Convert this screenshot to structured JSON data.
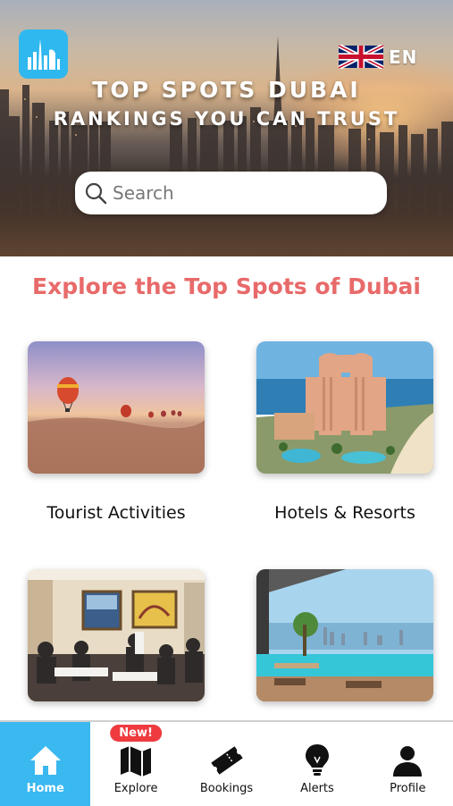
{
  "header": {
    "title": "TOP SPOTS DUBAI",
    "subtitle": "RANKINGS YOU CAN TRUST",
    "language": "EN",
    "logo_icon": "dubai-skyline-logo-icon",
    "flag_icon": "uk-flag-icon"
  },
  "search": {
    "placeholder": "Search",
    "value": ""
  },
  "main": {
    "section_title": "Explore the Top Spots of Dubai",
    "categories": [
      {
        "label": "Tourist Activities",
        "image": "hot-air-balloons-desert"
      },
      {
        "label": "Hotels & Resorts",
        "image": "atlantis-resort"
      },
      {
        "label": "",
        "image": "restaurant-interior"
      },
      {
        "label": "",
        "image": "infinity-pool-skyline"
      }
    ]
  },
  "nav": {
    "items": [
      {
        "label": "Home",
        "icon": "home-icon",
        "active": true
      },
      {
        "label": "Explore",
        "icon": "map-icon",
        "badge": "New!"
      },
      {
        "label": "Bookings",
        "icon": "ticket-icon"
      },
      {
        "label": "Alerts",
        "icon": "lightbulb-icon"
      },
      {
        "label": "Profile",
        "icon": "user-icon"
      }
    ]
  },
  "colors": {
    "accent": "#3ab8f0",
    "section_title": "#e86a6a",
    "badge": "#ef3b3f"
  }
}
